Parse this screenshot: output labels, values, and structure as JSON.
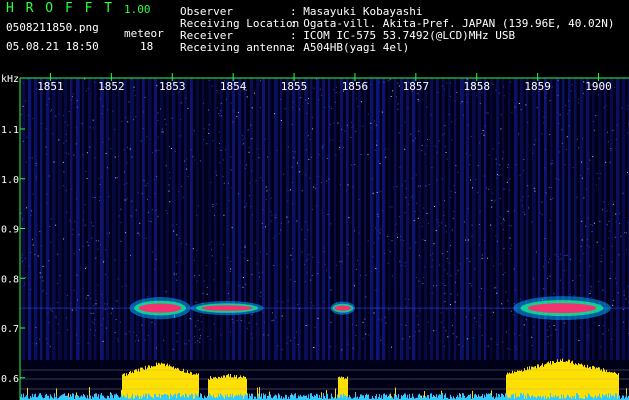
{
  "header": {
    "app_name": "H R O F F T",
    "version": "1.00",
    "filename": "0508211850.png",
    "datetime": "05.08.21 18:50",
    "meteor_label": "meteor",
    "meteor_count": "18",
    "info": [
      {
        "label": "Observer",
        "value": ": Masayuki Kobayashi"
      },
      {
        "label": "Receiving Location",
        "value": ": Ogata-vill. Akita-Pref. JAPAN (139.96E, 40.02N)"
      },
      {
        "label": "Receiver",
        "value": ": ICOM IC-575 53.7492(@LCD)MHz USB"
      },
      {
        "label": "Receiving antenna",
        "value": ": A504HB(yagi 4el)"
      }
    ]
  },
  "chart_data": {
    "type": "heatmap",
    "title": "",
    "xlabel": "",
    "ylabel": "kHz",
    "x_ticks": [
      "1851",
      "1852",
      "1853",
      "1854",
      "1855",
      "1856",
      "1857",
      "1858",
      "1859",
      "1900"
    ],
    "y_ticks": [
      "1.1",
      "1.0",
      "0.9",
      "0.8",
      "0.7",
      "0.6"
    ],
    "ylim": [
      0.58,
      1.16
    ],
    "colors": {
      "axis": "#2bff3c",
      "signal_low": "#1c2ad8",
      "signal_high": "#ff2a6e",
      "level_bars": "#ffe100",
      "noise_bars": "#31c9ff"
    },
    "echoes": [
      {
        "start": "18:52.3",
        "end": "18:53.3",
        "freq_khz": 0.74,
        "strength": 0.9
      },
      {
        "start": "18:53.3",
        "end": "18:54.5",
        "freq_khz": 0.74,
        "strength": 0.45
      },
      {
        "start": "18:55.6",
        "end": "18:56.0",
        "freq_khz": 0.74,
        "strength": 0.4
      },
      {
        "start": "18:58.6",
        "end": "19:00.2",
        "freq_khz": 0.74,
        "strength": 1.0
      }
    ]
  }
}
